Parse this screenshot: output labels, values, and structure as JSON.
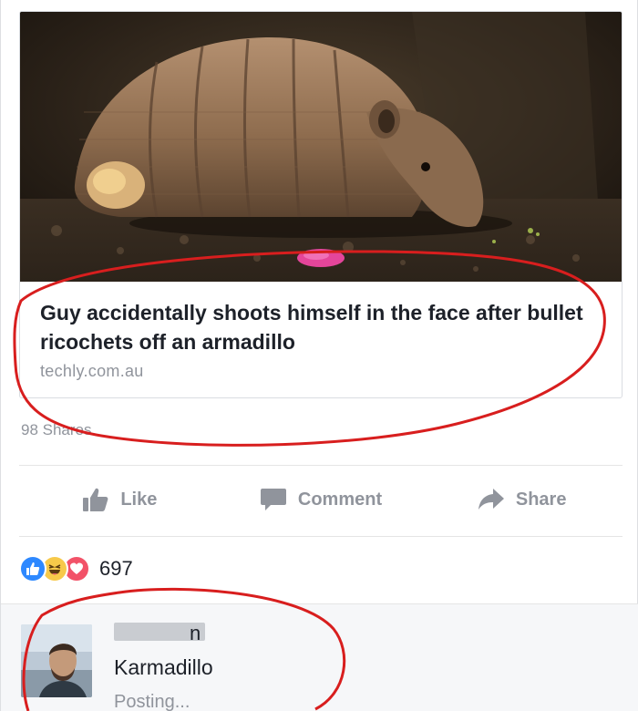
{
  "link_preview": {
    "title": "Guy accidentally shoots himself in the face after bullet ricochets off an armadillo",
    "domain": "techly.com.au",
    "image": "armadillo-photo"
  },
  "shares": "98 Shares",
  "actions": [
    {
      "label": "Like",
      "icon": "thumbs-up-icon"
    },
    {
      "label": "Comment",
      "icon": "comment-bubble-icon"
    },
    {
      "label": "Share",
      "icon": "share-arrow-icon"
    }
  ],
  "reactions": {
    "icons": [
      "like-reaction-icon",
      "haha-reaction-icon",
      "love-reaction-icon"
    ],
    "count": "697"
  },
  "comment": {
    "name_visible_fragment": "n",
    "text": "Karmadillo",
    "status": "Posting..."
  },
  "colors": {
    "like_blue": "#2d88ff",
    "haha_yellow": "#f7c94a",
    "love_red": "#f25268",
    "annotation_red": "#d81e1e",
    "muted_text": "#90949c"
  }
}
